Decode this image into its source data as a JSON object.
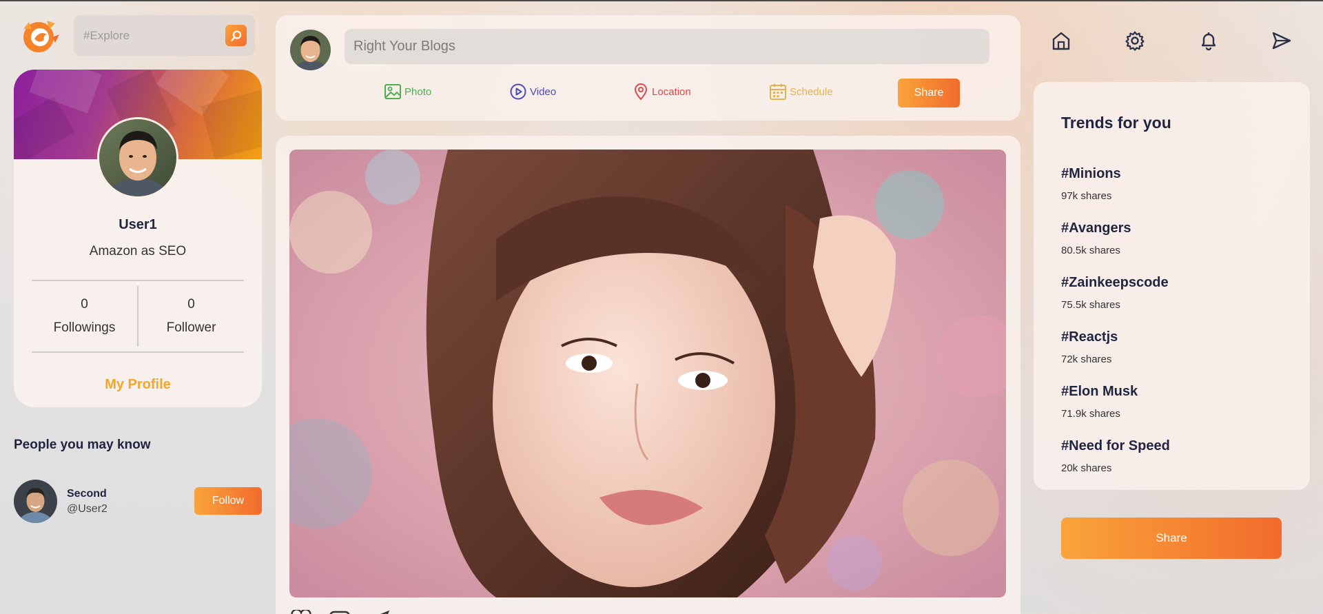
{
  "search": {
    "placeholder": "#Explore"
  },
  "profile": {
    "name": "User1",
    "bio": "Amazon as SEO",
    "followings_count": "0",
    "followings_label": "Followings",
    "followers_count": "0",
    "followers_label": "Follower",
    "link_label": "My Profile"
  },
  "people_you_may_know": {
    "title": "People you may know",
    "items": [
      {
        "name": "Second",
        "handle": "@User2",
        "button": "Follow"
      }
    ]
  },
  "composer": {
    "placeholder": "Right Your Blogs",
    "actions": {
      "photo": "Photo",
      "video": "Video",
      "location": "Location",
      "schedule": "Schedule"
    },
    "share_label": "Share"
  },
  "nav": {
    "icons": [
      "home-icon",
      "gear-icon",
      "bell-icon",
      "send-icon"
    ]
  },
  "trends": {
    "title": "Trends for you",
    "items": [
      {
        "tag": "#Minions",
        "shares": "97k shares"
      },
      {
        "tag": "#Avangers",
        "shares": "80.5k shares"
      },
      {
        "tag": "#Zainkeepscode",
        "shares": "75.5k shares"
      },
      {
        "tag": "#Reactjs",
        "shares": "72k shares"
      },
      {
        "tag": "#Elon Musk",
        "shares": "71.9k shares"
      },
      {
        "tag": "#Need for Speed",
        "shares": "20k shares"
      }
    ]
  },
  "side_share_label": "Share",
  "colors": {
    "accent_start": "#f9a43a",
    "accent_end": "#f26b2c",
    "profile_link": "#f5a623",
    "text_dark": "#1f2440"
  }
}
